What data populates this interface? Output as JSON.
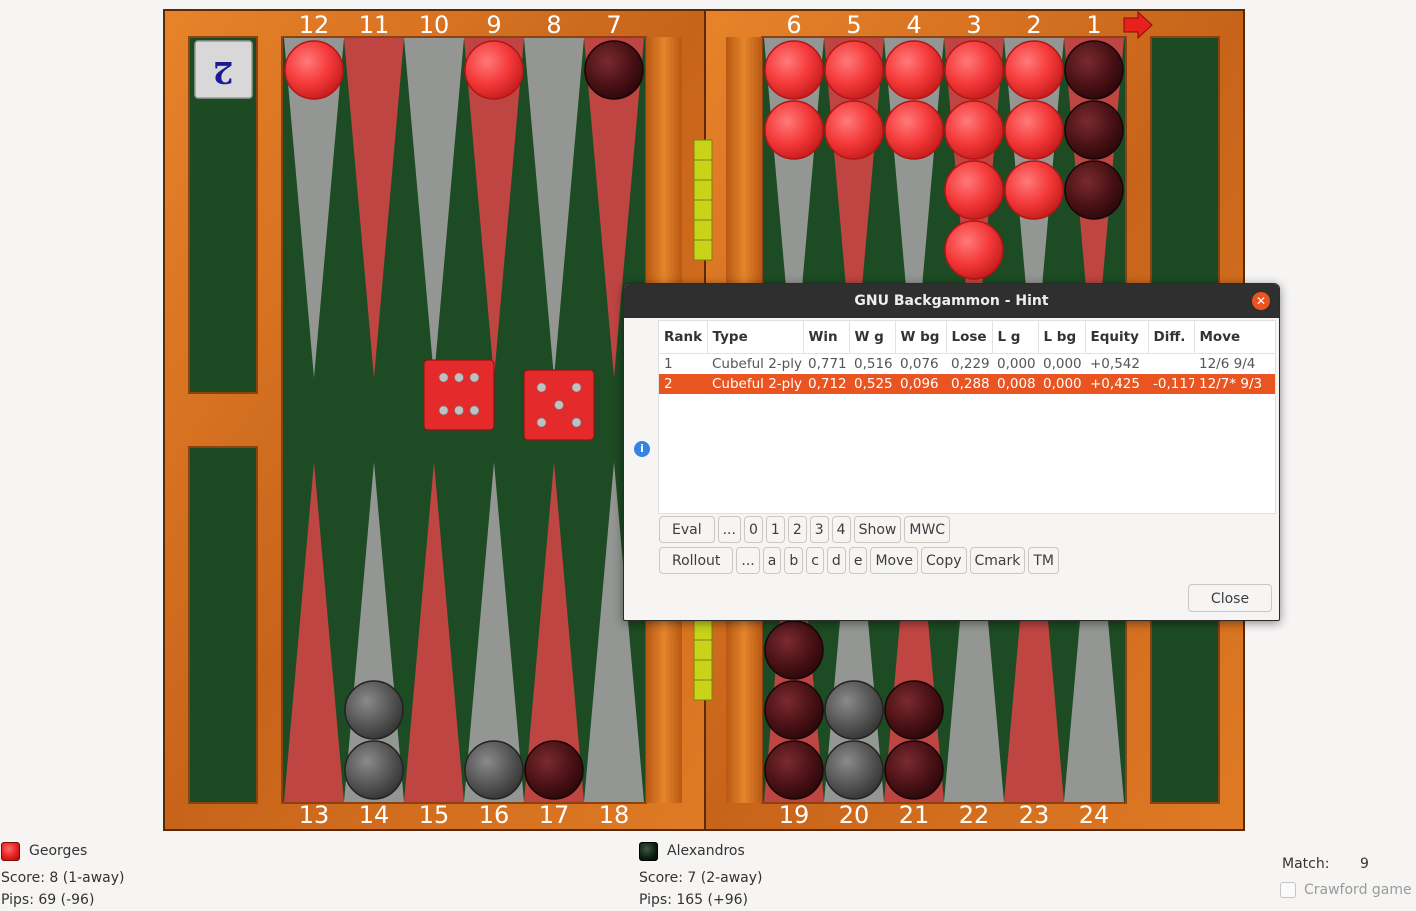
{
  "board": {
    "top_point_numbers": [
      "12",
      "11",
      "10",
      "9",
      "8",
      "7",
      "6",
      "5",
      "4",
      "3",
      "2",
      "1"
    ],
    "bottom_point_numbers": [
      "13",
      "14",
      "15",
      "16",
      "17",
      "18",
      "19",
      "20",
      "21",
      "22",
      "23",
      "24"
    ],
    "cube_value": "2",
    "dice": [
      6,
      5
    ],
    "checkers": {
      "red": [
        {
          "point": 12,
          "count": 1
        },
        {
          "point": 9,
          "count": 1
        },
        {
          "point": 6,
          "count": 2
        },
        {
          "point": 5,
          "count": 2
        },
        {
          "point": 4,
          "count": 2
        },
        {
          "point": 3,
          "count": 4
        },
        {
          "point": 2,
          "count": 3
        }
      ],
      "dark": [
        {
          "point": 7,
          "count": 1
        },
        {
          "point": 1,
          "count": 3
        },
        {
          "point": 14,
          "count": 2
        },
        {
          "point": 16,
          "count": 1
        },
        {
          "point": 17,
          "count": 1
        },
        {
          "point": 19,
          "count": 3
        },
        {
          "point": 20,
          "count": 2
        },
        {
          "point": 21,
          "count": 2
        }
      ]
    },
    "colors": {
      "red_checker": "#ff4040",
      "dark_checker": "#4a1216",
      "grey_checker": "#555555",
      "frame": "#d9741c",
      "felt": "#1c4a22",
      "red_point": "#c84444",
      "grey_point": "#9a9a9a"
    }
  },
  "players": {
    "georges": {
      "name": "Georges",
      "score": "Score:  8 (1-away)",
      "pips": "Pips: 69 (-96)"
    },
    "alexandros": {
      "name": "Alexandros",
      "score": "Score:  7 (2-away)",
      "pips": "Pips: 165 (+96)"
    }
  },
  "match": {
    "label": "Match:",
    "value": "9",
    "crawford_label": "Crawford game"
  },
  "hint": {
    "title": "GNU Backgammon - Hint",
    "close_x": "✕",
    "columns": [
      "Rank",
      "Type",
      "Win",
      "W g",
      "W bg",
      "Lose",
      "L g",
      "L bg",
      "Equity",
      "Diff.",
      "Move"
    ],
    "rows": [
      [
        "1",
        "Cubeful 2-ply",
        "0,771",
        "0,516",
        "0,076",
        "0,229",
        "0,000",
        "0,000",
        "+0,542",
        "",
        "12/6 9/4"
      ],
      [
        "2",
        "Cubeful 2-ply",
        "0,712",
        "0,525",
        "0,096",
        "0,288",
        "0,008",
        "0,000",
        "+0,425",
        "-0,117",
        "12/7* 9/3"
      ]
    ],
    "buttons_row1": [
      "Eval",
      "...",
      "0",
      "1",
      "2",
      "3",
      "4",
      "Show",
      "MWC"
    ],
    "buttons_row2": [
      "Rollout",
      "...",
      "a",
      "b",
      "c",
      "d",
      "e",
      "Move",
      "Copy",
      "Cmark",
      "TM"
    ],
    "close_label": "Close",
    "info_icon": "i"
  }
}
